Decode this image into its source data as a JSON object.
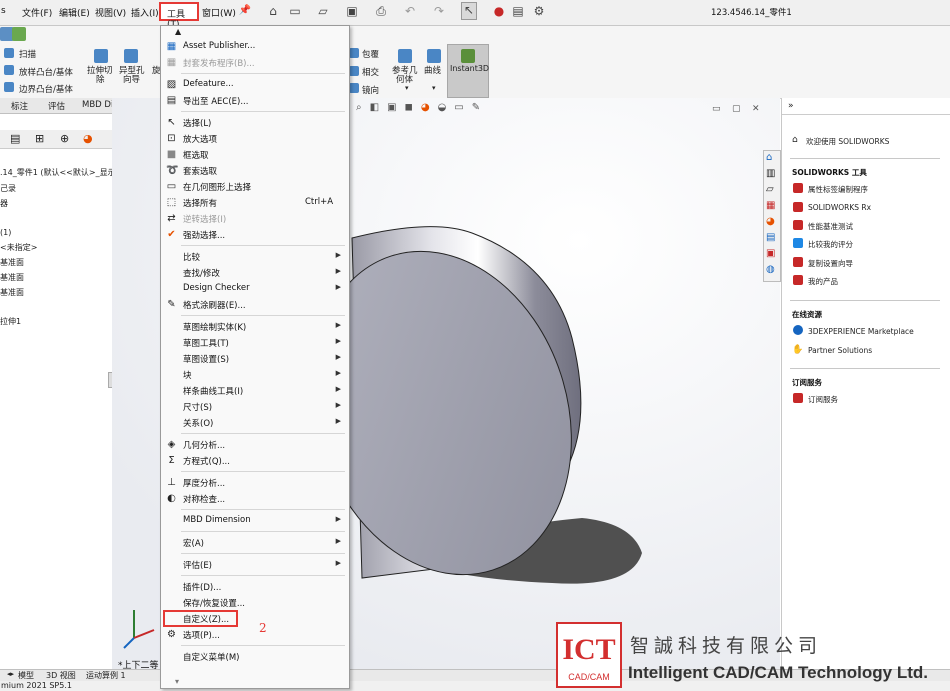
{
  "menubar": {
    "items": [
      "文件(F)",
      "编辑(E)",
      "视图(V)",
      "插入(I)",
      "工具(T)",
      "窗口(W)"
    ],
    "left_clip": "s",
    "title": "123.4546.14_零件1"
  },
  "annotations": {
    "mark1": "1",
    "mark2": "2"
  },
  "commands": {
    "sweep": "扫描",
    "loft": "放样凸台/基体",
    "boundary": "边界凸台/基体",
    "extrude_cut_l1": "拉伸切",
    "extrude_cut_l2": "除",
    "hole_l1": "异型孔",
    "hole_l2": "向导",
    "revolve_clip": "旋",
    "wrap": "包覆",
    "intersect": "相交",
    "mirror": "镜向",
    "ref_geom_l1": "参考几",
    "ref_geom_l2": "何体",
    "curves": "曲线",
    "instant3d": "Instant3D"
  },
  "tabs": [
    "标注",
    "评估",
    "MBD Dimensions",
    "S("
  ],
  "tree": [
    ".14_零件1  (默认<<默认>_显示",
    "己录",
    "器",
    "(1)",
    "<未指定>",
    "基准面",
    "基准面",
    "基准面",
    "拉伸1"
  ],
  "dropdown": [
    {
      "label": "Asset Publisher...",
      "icon": "asset-publisher-icon"
    },
    {
      "label": "封套发布程序(B)...",
      "disabled": true,
      "icon": "envelope-publisher-icon"
    },
    {
      "sep": true
    },
    {
      "label": "Defeature...",
      "icon": "defeature-icon"
    },
    {
      "label": "导出至 AEC(E)...",
      "icon": "export-aec-icon"
    },
    {
      "sep": true
    },
    {
      "label": "选择(L)",
      "icon": "select-arrow-icon"
    },
    {
      "label": "放大选项",
      "icon": "magnified-select-icon"
    },
    {
      "label": "框选取",
      "icon": "box-select-icon"
    },
    {
      "label": "套索选取",
      "icon": "lasso-select-icon"
    },
    {
      "label": "在几何图形上选择",
      "icon": "select-over-geometry-icon"
    },
    {
      "label": "选择所有",
      "shortcut": "Ctrl+A",
      "icon": "select-all-icon"
    },
    {
      "label": "逆转选择(I)",
      "disabled": true,
      "icon": "invert-select-icon"
    },
    {
      "label": "强劲选择...",
      "icon": "power-select-icon"
    },
    {
      "sep": true
    },
    {
      "label": "比较",
      "sub": true
    },
    {
      "label": "查找/修改",
      "sub": true
    },
    {
      "label": "Design Checker",
      "sub": true
    },
    {
      "label": "格式涂刷器(E)...",
      "icon": "format-painter-icon"
    },
    {
      "sep": true
    },
    {
      "label": "草图绘制实体(K)",
      "sub": true
    },
    {
      "label": "草图工具(T)",
      "sub": true
    },
    {
      "label": "草图设置(S)",
      "sub": true
    },
    {
      "label": "块",
      "sub": true
    },
    {
      "label": "样条曲线工具(I)",
      "sub": true
    },
    {
      "label": "尺寸(S)",
      "sub": true
    },
    {
      "label": "关系(O)",
      "sub": true
    },
    {
      "sep": true
    },
    {
      "label": "几何分析...",
      "icon": "geometry-analysis-icon"
    },
    {
      "label": "方程式(Q)...",
      "icon": "sigma-icon"
    },
    {
      "sep": true
    },
    {
      "label": "厚度分析...",
      "icon": "thickness-analysis-icon"
    },
    {
      "label": "对称检查...",
      "icon": "symmetry-check-icon"
    },
    {
      "sep": true
    },
    {
      "label": "MBD Dimension",
      "sub": true
    },
    {
      "sep": true
    },
    {
      "label": "宏(A)",
      "sub": true
    },
    {
      "sep": true
    },
    {
      "label": "评估(E)",
      "sub": true
    },
    {
      "sep": true
    },
    {
      "label": "插件(D)..."
    },
    {
      "label": "保存/恢复设置..."
    },
    {
      "label": "自定义(Z)..."
    },
    {
      "label": "选项(P)...",
      "icon": "gear-icon"
    },
    {
      "sep": true
    },
    {
      "label": "自定义菜单(M)"
    }
  ],
  "rightpanel": {
    "welcome": "欢迎使用 SOLIDWORKS",
    "tools_header": "SOLIDWORKS 工具",
    "tools": [
      "属性标签编制程序",
      "SOLIDWORKS Rx",
      "性能基准测试",
      "比较我的评分",
      "复制设置向导",
      "我的产品"
    ],
    "online_header": "在线资源",
    "online": [
      "3DEXPERIENCE Marketplace",
      "Partner Solutions"
    ],
    "sub_header": "订阅服务",
    "sub": [
      "订阅服务"
    ]
  },
  "viewport": {
    "view_label": "*上下二等"
  },
  "bottom": {
    "tabs": [
      "模型",
      "3D 视图",
      "运动算例 1"
    ],
    "status": "mium 2021 SP5.1"
  },
  "watermark": {
    "logo_big": "ICT",
    "logo_small": "CAD/CAM",
    "cn": "智誠科技有限公司",
    "en": "Intelligent CAD/CAM Technology Ltd."
  },
  "colors": {
    "highlight_red": "#e53935",
    "logo_red": "#d32f2f"
  }
}
